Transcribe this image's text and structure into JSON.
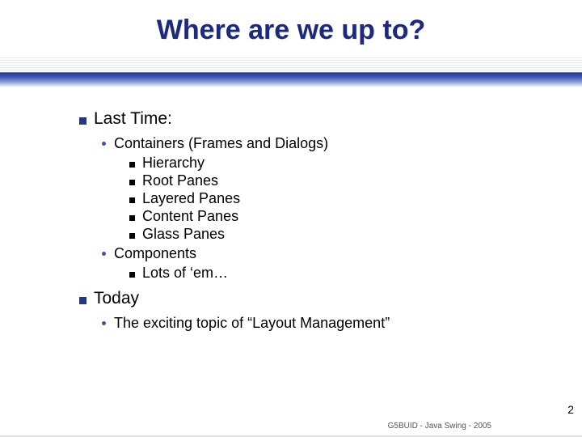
{
  "title": "Where are we up to?",
  "sections": {
    "lastTime": {
      "heading": "Last Time:",
      "items": [
        {
          "label": "Containers (Frames and Dialogs)",
          "sub": [
            "Hierarchy",
            "Root Panes",
            "Layered Panes",
            "Content Panes",
            "Glass Panes"
          ]
        },
        {
          "label": "Components",
          "sub": [
            "Lots of ‘em…"
          ]
        }
      ]
    },
    "today": {
      "heading": "Today",
      "items": [
        {
          "label": "The exciting topic of “Layout Management”",
          "sub": []
        }
      ]
    }
  },
  "footer": {
    "course": "G5BUID - Java Swing - 2005",
    "page": "2"
  }
}
